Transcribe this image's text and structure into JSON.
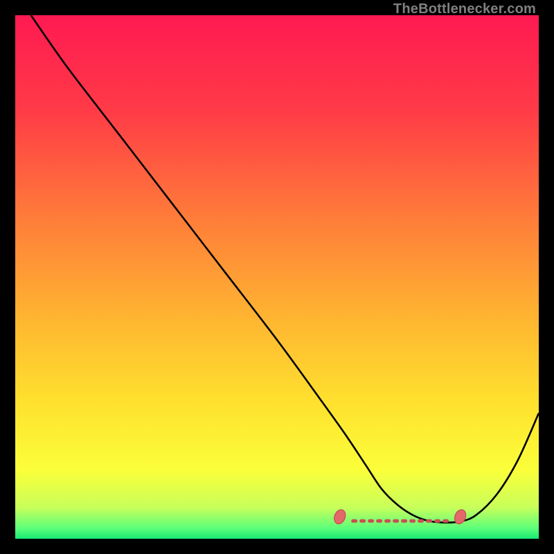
{
  "attribution": "TheBottlenecker.com",
  "chart_data": {
    "type": "line",
    "title": "",
    "xlabel": "",
    "ylabel": "",
    "xlim": [
      0,
      100
    ],
    "ylim": [
      0,
      100
    ],
    "series": [
      {
        "name": "curve",
        "x": [
          3,
          10,
          20,
          30,
          40,
          50,
          58,
          63,
          67,
          70,
          73,
          76,
          79,
          82,
          85,
          88,
          92,
          96,
          100
        ],
        "y": [
          100,
          90,
          77,
          64,
          51,
          38,
          27,
          20,
          14,
          9.5,
          6.5,
          4.5,
          3.4,
          3.1,
          3.3,
          4.5,
          8.5,
          15,
          24
        ]
      }
    ],
    "optimal_zone": {
      "x_start": 61,
      "x_end": 86,
      "marker_left": {
        "x": 62,
        "y": 4.2
      },
      "marker_right": {
        "x": 85,
        "y": 4.2
      },
      "dash_y": 3.4,
      "dash_x_start": 64.5,
      "dash_x_end": 83
    },
    "gradient_stops": [
      {
        "offset": 0,
        "color": "#ff1a52"
      },
      {
        "offset": 18,
        "color": "#ff3a47"
      },
      {
        "offset": 38,
        "color": "#ff7a3a"
      },
      {
        "offset": 58,
        "color": "#ffb531"
      },
      {
        "offset": 74,
        "color": "#ffe12e"
      },
      {
        "offset": 87,
        "color": "#fbff3a"
      },
      {
        "offset": 94,
        "color": "#c8ff5a"
      },
      {
        "offset": 98,
        "color": "#5cff7a"
      },
      {
        "offset": 100,
        "color": "#18e874"
      }
    ],
    "colors": {
      "curve": "#000000",
      "marker_fill": "#e46a6a",
      "marker_stroke": "#c94f54"
    }
  }
}
